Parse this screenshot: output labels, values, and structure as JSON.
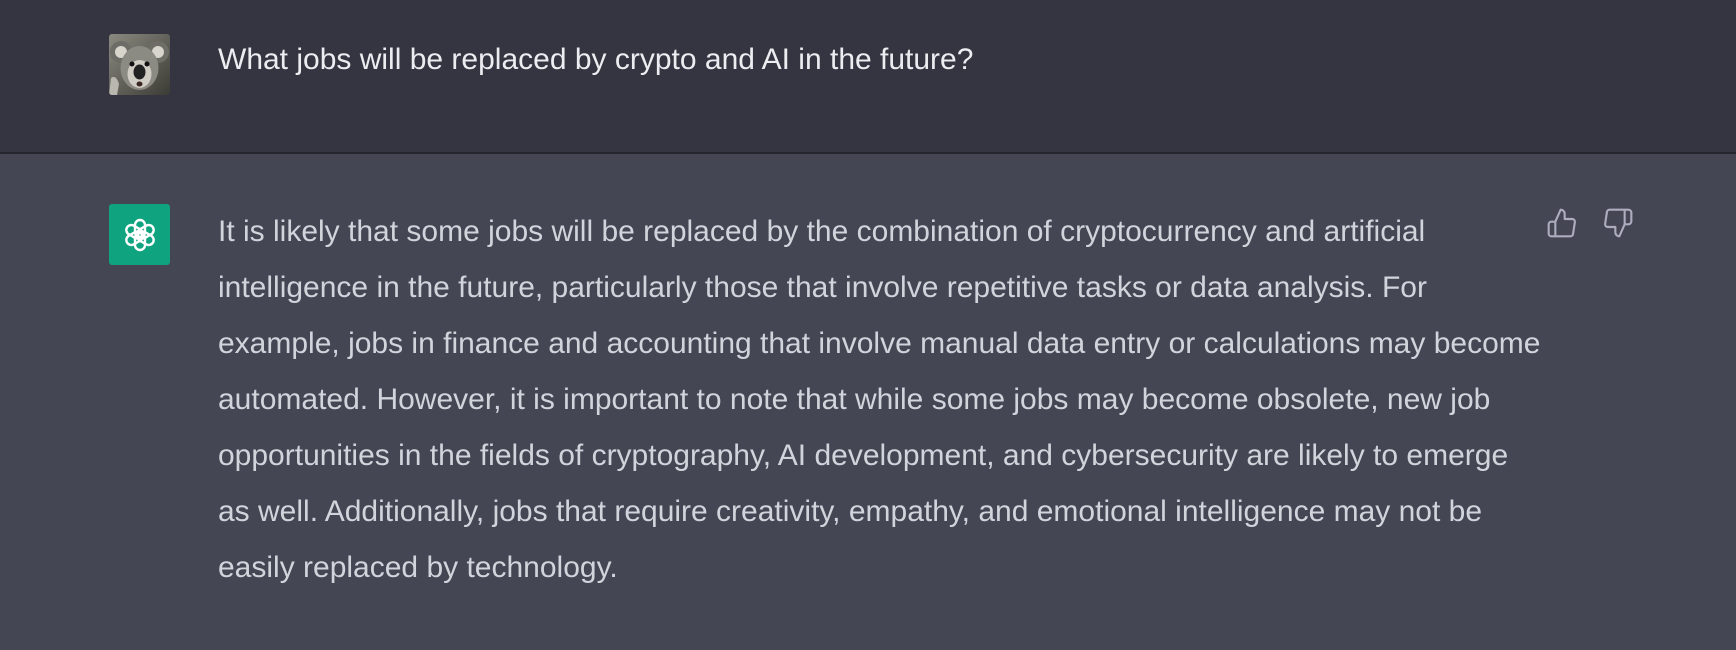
{
  "conversation": {
    "user_message": {
      "avatar_icon": "koala-avatar-icon",
      "text": "What jobs will be replaced by crypto and AI in the future?"
    },
    "assistant_message": {
      "avatar_icon": "openai-logo-icon",
      "text": "It is likely that some jobs will be replaced by the combination of cryptocurrency and artificial intelligence in the future, particularly those that involve repetitive tasks or data analysis. For example, jobs in finance and accounting that involve manual data entry or calculations may become automated. However, it is important to note that while some jobs may become obsolete, new job opportunities in the fields of cryptography, AI development, and cybersecurity are likely to emerge as well. Additionally, jobs that require creativity, empathy, and emotional intelligence may not be easily replaced by technology."
    },
    "feedback": {
      "thumbs_up_icon": "thumbs-up-icon",
      "thumbs_down_icon": "thumbs-down-icon"
    }
  },
  "colors": {
    "user_row_bg": "#343541",
    "assistant_row_bg": "#444654",
    "brand_green": "#10a37f",
    "text_primary": "#ececf1",
    "text_secondary": "#d1d5db",
    "icon_gray": "#acacbe"
  }
}
